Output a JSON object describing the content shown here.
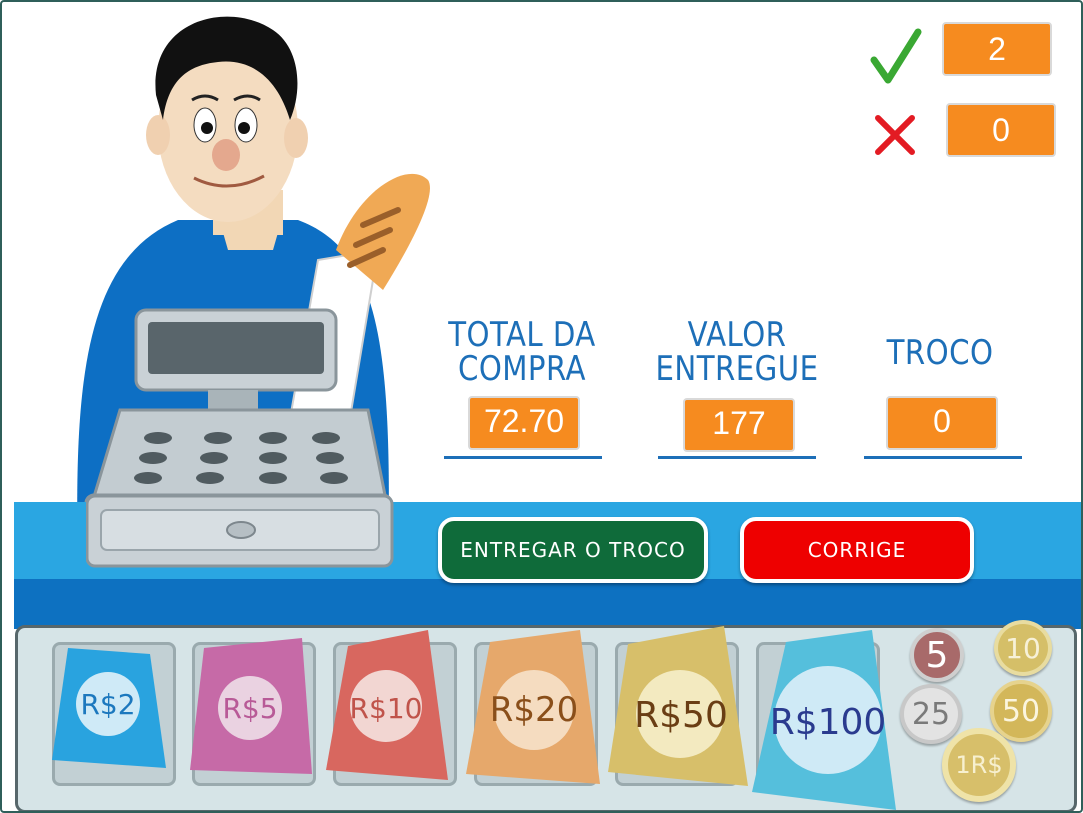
{
  "score": {
    "correct_icon": "check-icon",
    "correct_value": "2",
    "wrong_icon": "cross-icon",
    "wrong_value": "0"
  },
  "stats": {
    "total_label_1": "TOTAL DA",
    "total_label_2": "COMPRA",
    "total_value": "72.70",
    "given_label_1": "VALOR",
    "given_label_2": "ENTREGUE",
    "given_value": "177",
    "change_label": "TROCO",
    "change_value": "0"
  },
  "buttons": {
    "deliver": "ENTREGAR O TROCO",
    "correct": "CORRIGE"
  },
  "notes": [
    {
      "label": "R$2",
      "color": "#29a3df"
    },
    {
      "label": "R$5",
      "color": "#c66aa7"
    },
    {
      "label": "R$10",
      "color": "#d8675f"
    },
    {
      "label": "R$20",
      "color": "#e6a86b"
    },
    {
      "label": "R$50",
      "color": "#d7bf6a"
    },
    {
      "label": "R$100",
      "color": "#55bfdc"
    }
  ],
  "coins": [
    {
      "label": "5",
      "color": "#a86a6a"
    },
    {
      "label": "10",
      "color": "#d5bf68"
    },
    {
      "label": "25",
      "color": "#e3e3e3"
    },
    {
      "label": "50",
      "color": "#d3b75a"
    },
    {
      "label": "1R$",
      "color": "#d7bf6a"
    }
  ],
  "colors": {
    "accent_orange": "#f68b1f",
    "label_blue": "#1d6fb8",
    "button_green": "#0f6b3a",
    "button_red": "#ee0000"
  }
}
